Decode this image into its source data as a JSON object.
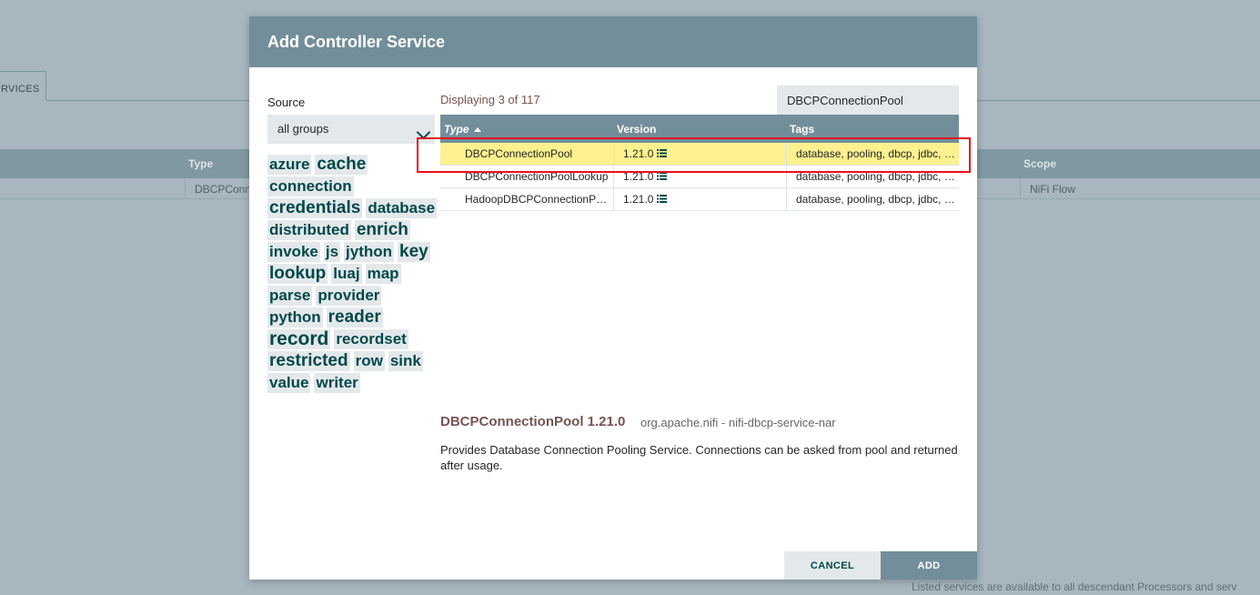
{
  "background": {
    "tab_label": "RVICES",
    "columns": {
      "type": "Type",
      "scope": "Scope"
    },
    "row": {
      "type": "DBCPConne",
      "scope": "NiFi Flow"
    },
    "footer_text": "Listed services are available to all descendant Processors and serv"
  },
  "dialog": {
    "title": "Add Controller Service",
    "source": {
      "label": "Source",
      "selected": "all groups"
    },
    "tags": [
      "azure",
      "cache",
      "connection",
      "credentials",
      "database",
      "distributed",
      "enrich",
      "invoke",
      "js",
      "jython",
      "key",
      "lookup",
      "luaj",
      "map",
      "parse",
      "provider",
      "python",
      "reader",
      "record",
      "recordset",
      "restricted",
      "row",
      "sink",
      "value",
      "writer"
    ],
    "displaying": "Displaying 3 of 117",
    "filter": {
      "value": "DBCPConnectionPool"
    },
    "grid": {
      "columns": {
        "type": "Type",
        "version": "Version",
        "tags": "Tags"
      },
      "rows": [
        {
          "type": "DBCPConnectionPool",
          "version": "1.21.0",
          "tags": "database, pooling, dbcp, jdbc, c..."
        },
        {
          "type": "DBCPConnectionPoolLookup",
          "version": "1.21.0",
          "tags": "database, pooling, dbcp, jdbc, c..."
        },
        {
          "type": "HadoopDBCPConnectionPool",
          "version": "1.21.0",
          "tags": "database, pooling, dbcp, jdbc, c..."
        }
      ]
    },
    "description": {
      "title": "DBCPConnectionPool 1.21.0",
      "bundle": "org.apache.nifi - nifi-dbcp-service-nar",
      "text": "Provides Database Connection Pooling Service. Connections can be asked from pool and returned after usage."
    },
    "buttons": {
      "cancel": "CANCEL",
      "add": "ADD"
    }
  },
  "colors": {
    "header": "#728e9b",
    "selected_row": "#fcf18e",
    "highlight_border": "#e8121c",
    "tag_text": "#004849",
    "accent_text": "#775351"
  }
}
